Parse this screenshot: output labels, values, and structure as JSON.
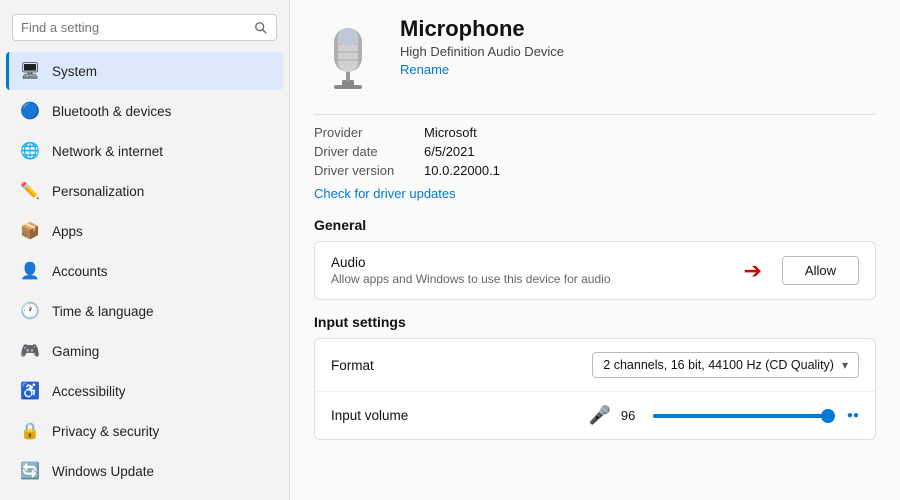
{
  "search": {
    "placeholder": "Find a setting"
  },
  "sidebar": {
    "items": [
      {
        "id": "system",
        "label": "System",
        "icon": "🖥",
        "active": true
      },
      {
        "id": "bluetooth",
        "label": "Bluetooth & devices",
        "icon": "🔵"
      },
      {
        "id": "network",
        "label": "Network & internet",
        "icon": "🌐"
      },
      {
        "id": "personalization",
        "label": "Personalization",
        "icon": "✏️"
      },
      {
        "id": "apps",
        "label": "Apps",
        "icon": "📦"
      },
      {
        "id": "accounts",
        "label": "Accounts",
        "icon": "👤"
      },
      {
        "id": "time",
        "label": "Time & language",
        "icon": "🕐"
      },
      {
        "id": "gaming",
        "label": "Gaming",
        "icon": "🎮"
      },
      {
        "id": "accessibility",
        "label": "Accessibility",
        "icon": "♿"
      },
      {
        "id": "privacy",
        "label": "Privacy & security",
        "icon": "🔒"
      },
      {
        "id": "update",
        "label": "Windows Update",
        "icon": "🔄"
      }
    ]
  },
  "device": {
    "name": "Microphone",
    "subtitle": "High Definition Audio Device",
    "rename_label": "Rename"
  },
  "driver": {
    "provider_label": "Provider",
    "provider_value": "Microsoft",
    "date_label": "Driver date",
    "date_value": "6/5/2021",
    "version_label": "Driver version",
    "version_value": "10.0.22000.1",
    "check_link": "Check for driver updates"
  },
  "sections": {
    "general": {
      "title": "General",
      "audio": {
        "title": "Audio",
        "desc": "Allow apps and Windows to use this device for audio",
        "action_label": "Allow"
      }
    },
    "input_settings": {
      "title": "Input settings",
      "format": {
        "label": "Format",
        "value": "2 channels, 16 bit, 44100 Hz (CD Quality)"
      },
      "volume": {
        "label": "Input volume",
        "value": "96",
        "fill_percent": 96
      }
    }
  }
}
